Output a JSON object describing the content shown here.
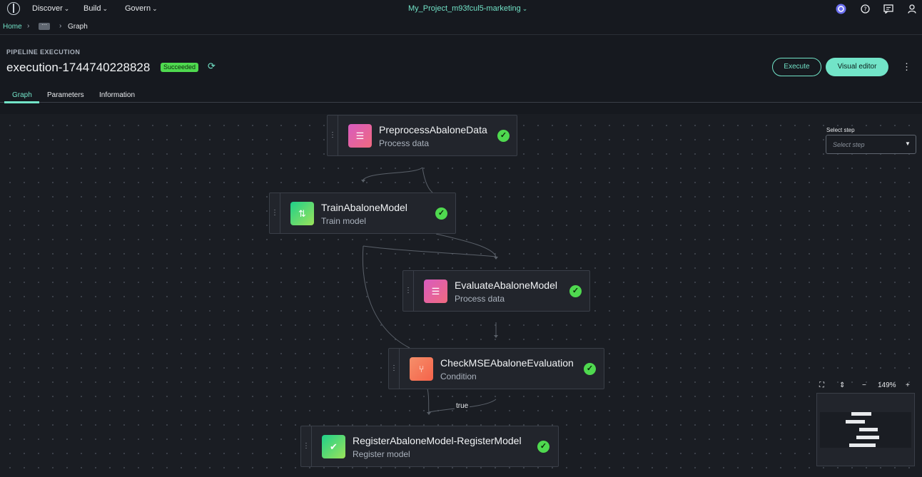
{
  "topbar": {
    "nav": [
      "Discover",
      "Build",
      "Govern"
    ],
    "project": "My_Project_m93fcul5-marketing",
    "icons": [
      "logo-icon",
      "project-switch-icon",
      "help-icon",
      "notifications-icon",
      "user-icon"
    ]
  },
  "breadcrumb": {
    "home": "Home",
    "ellipsis": "···",
    "current": "Graph"
  },
  "header": {
    "label": "PIPELINE EXECUTION",
    "title": "execution-1744740228828",
    "status": "Succeeded",
    "execute": "Execute",
    "visual_editor": "Visual editor"
  },
  "tabs": [
    "Graph",
    "Parameters",
    "Information"
  ],
  "select_step": {
    "label": "Select step",
    "placeholder": "Select step"
  },
  "nodes": [
    {
      "title": "PreprocessAbaloneData",
      "subtitle": "Process data",
      "icon": "database-icon"
    },
    {
      "title": "TrainAbaloneModel",
      "subtitle": "Train model",
      "icon": "train-icon"
    },
    {
      "title": "EvaluateAbaloneModel",
      "subtitle": "Process data",
      "icon": "database-icon"
    },
    {
      "title": "CheckMSEAbaloneEvaluation",
      "subtitle": "Condition",
      "icon": "condition-icon"
    },
    {
      "title": "RegisterAbaloneModel-RegisterModel",
      "subtitle": "Register model",
      "icon": "register-icon"
    }
  ],
  "edge_label": "true",
  "zoom": {
    "level": "149%"
  },
  "colors": {
    "accent": "#72e4c8",
    "success": "#4fd94f",
    "background": "#16191f"
  }
}
